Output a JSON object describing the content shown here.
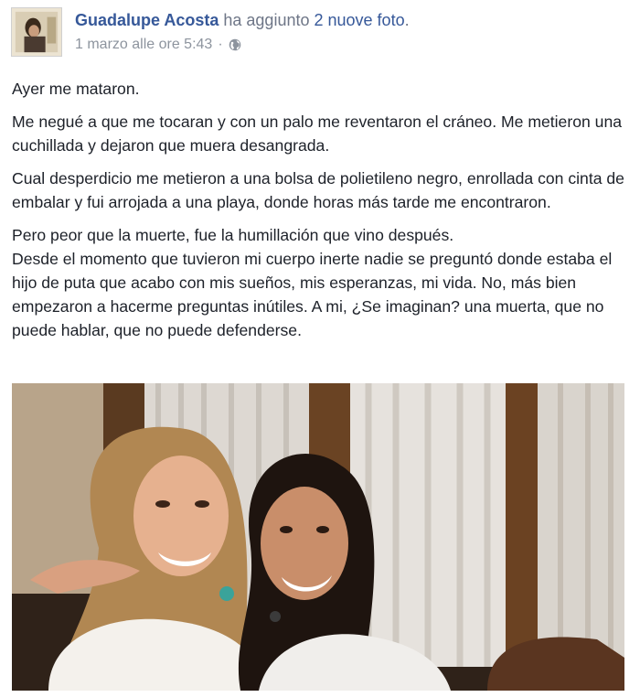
{
  "post": {
    "author": "Guadalupe Acosta",
    "action_prefix": "ha aggiunto",
    "photos_link": "2 nuove foto",
    "action_suffix": ".",
    "timestamp": "1 marzo alle ore 5:43",
    "separator": "·",
    "privacy_icon": "globe-icon",
    "paragraphs": [
      "Ayer me mataron.",
      "Me negué a que me tocaran y con un palo me reventaron el cráneo. Me metieron una cuchillada y dejaron que muera desangrada.",
      "Cual desperdicio me metieron a una bolsa de polietileno negro, enrollada con cinta de embalar y fui arrojada a una playa, donde horas más tarde me encontraron.",
      "Pero peor que la muerte, fue la humillación que vino después.\nDesde el momento que tuvieron mi cuerpo inerte nadie se preguntó donde estaba el hijo de puta que acabo con mis sueños, mis esperanzas, mi vida. No, más bien empezaron a hacerme preguntas inútiles. A mi, ¿Se imaginan? una muerta, que no puede hablar, que no puede defenderse."
    ]
  },
  "colors": {
    "link": "#365899",
    "muted": "#8d949e",
    "text": "#1d2129"
  }
}
